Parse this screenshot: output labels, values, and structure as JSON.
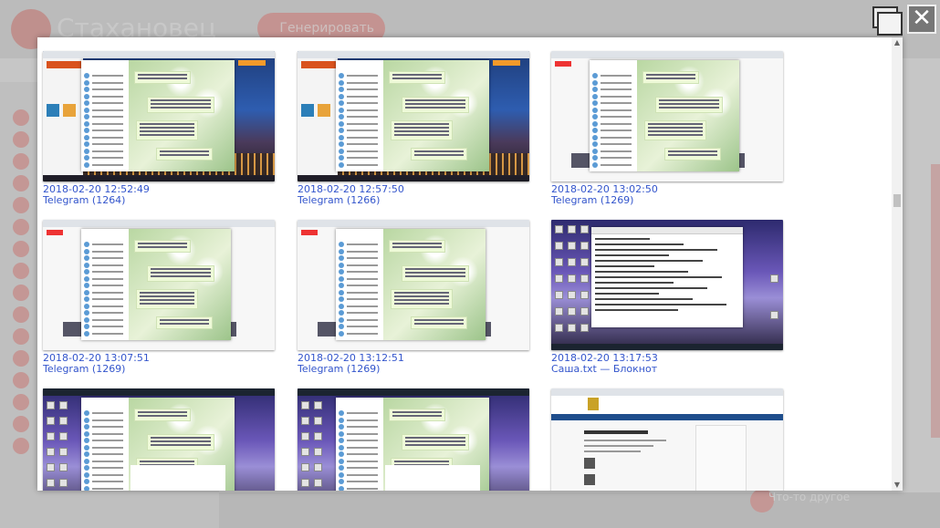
{
  "background_app": {
    "title": "Стахановец",
    "generate_button": "Генерировать",
    "bottom_label": "Что-то другое"
  },
  "controls": {
    "restore_icon": "restore-window-icon",
    "close_icon": "close-icon",
    "close_glyph": "✕"
  },
  "screenshots": [
    {
      "date": "2018-02-20 12:52:49",
      "title": "Telegram (1264)",
      "kind": "telegram-city"
    },
    {
      "date": "2018-02-20 12:57:50",
      "title": "Telegram (1266)",
      "kind": "telegram-city"
    },
    {
      "date": "2018-02-20 13:02:50",
      "title": "Telegram (1269)",
      "kind": "telegram-white"
    },
    {
      "date": "2018-02-20 13:07:51",
      "title": "Telegram (1269)",
      "kind": "telegram-white"
    },
    {
      "date": "2018-02-20 13:12:51",
      "title": "Telegram (1269)",
      "kind": "telegram-white"
    },
    {
      "date": "2018-02-20 13:17:53",
      "title": "Саша.txt — Блокнот",
      "kind": "notepad-purple"
    },
    {
      "date": "",
      "title": "",
      "kind": "telegram-purple"
    },
    {
      "date": "",
      "title": "",
      "kind": "telegram-purple"
    },
    {
      "date": "",
      "title": "",
      "kind": "website"
    }
  ],
  "scrollbar": {
    "up_glyph": "▲",
    "down_glyph": "▼"
  },
  "colors": {
    "link": "#3355cc",
    "accent": "#e0413a"
  }
}
